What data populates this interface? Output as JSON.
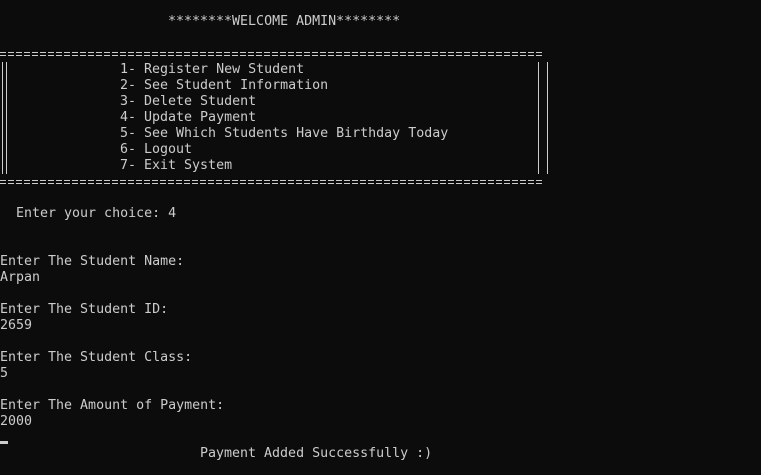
{
  "console": {
    "welcome": "********WELCOME ADMIN********",
    "menu": [
      "1- Register New Student",
      "2- See Student Information",
      "3- Delete Student",
      "4- Update Payment",
      "5- See Which Students Have Birthday Today",
      "6- Logout",
      "7- Exit System"
    ],
    "choice_prompt": "Enter your choice: 4",
    "prompts": {
      "name": "Enter The Student Name:",
      "name_value": "Arpan",
      "id": "Enter The Student ID:",
      "id_value": "2659",
      "class": "Enter The Student Class:",
      "class_value": "5",
      "amount": "Enter The Amount of Payment:",
      "amount_value": "2000"
    },
    "success": "Payment Added Successfully :)"
  }
}
